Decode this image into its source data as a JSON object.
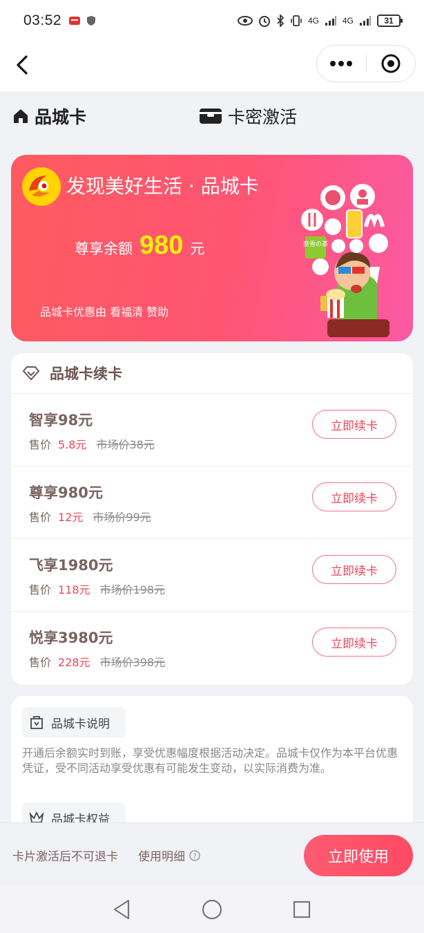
{
  "status_bar": {
    "time": "03:52",
    "network_1": "4G",
    "network_2": "4G",
    "battery": "31"
  },
  "tabs": {
    "brand": "品城卡",
    "activate": "卡密激活"
  },
  "hero": {
    "title": "发现美好生活 · 品城卡",
    "balance_label": "尊享余额",
    "balance_value": "980",
    "balance_unit": "元",
    "sponsor_prefix": "品城卡优惠由",
    "sponsor_name": "看福清",
    "sponsor_suffix": "赞助",
    "brand_badge": "奈雪の茶"
  },
  "renew": {
    "title": "品城卡续卡",
    "price_label": "售价",
    "plans": [
      {
        "name": "智享98元",
        "sale": "5.8元",
        "market": "市场价38元",
        "button": "立即续卡"
      },
      {
        "name": "尊享980元",
        "sale": "12元",
        "market": "市场价99元",
        "button": "立即续卡"
      },
      {
        "name": "飞享1980元",
        "sale": "118元",
        "market": "市场价198元",
        "button": "立即续卡"
      },
      {
        "name": "悦享3980元",
        "sale": "228元",
        "market": "市场价398元",
        "button": "立即续卡"
      }
    ]
  },
  "info": {
    "desc_title": "品城卡说明",
    "desc_text": "开通后余额实时到账，享受优惠幅度根据活动决定。品城卡仅作为本平台优惠凭证，受不同活动享受优惠有可能发生变动，以实际消费为准。",
    "rights_title": "品城卡权益"
  },
  "bottom": {
    "note": "卡片激活后不可退卡",
    "detail": "使用明细",
    "use_button": "立即使用"
  },
  "colors": {
    "accent": "#ff4a62",
    "hero_start": "#ff5a5f",
    "hero_end": "#fb5aa3",
    "balance": "#fff200"
  }
}
